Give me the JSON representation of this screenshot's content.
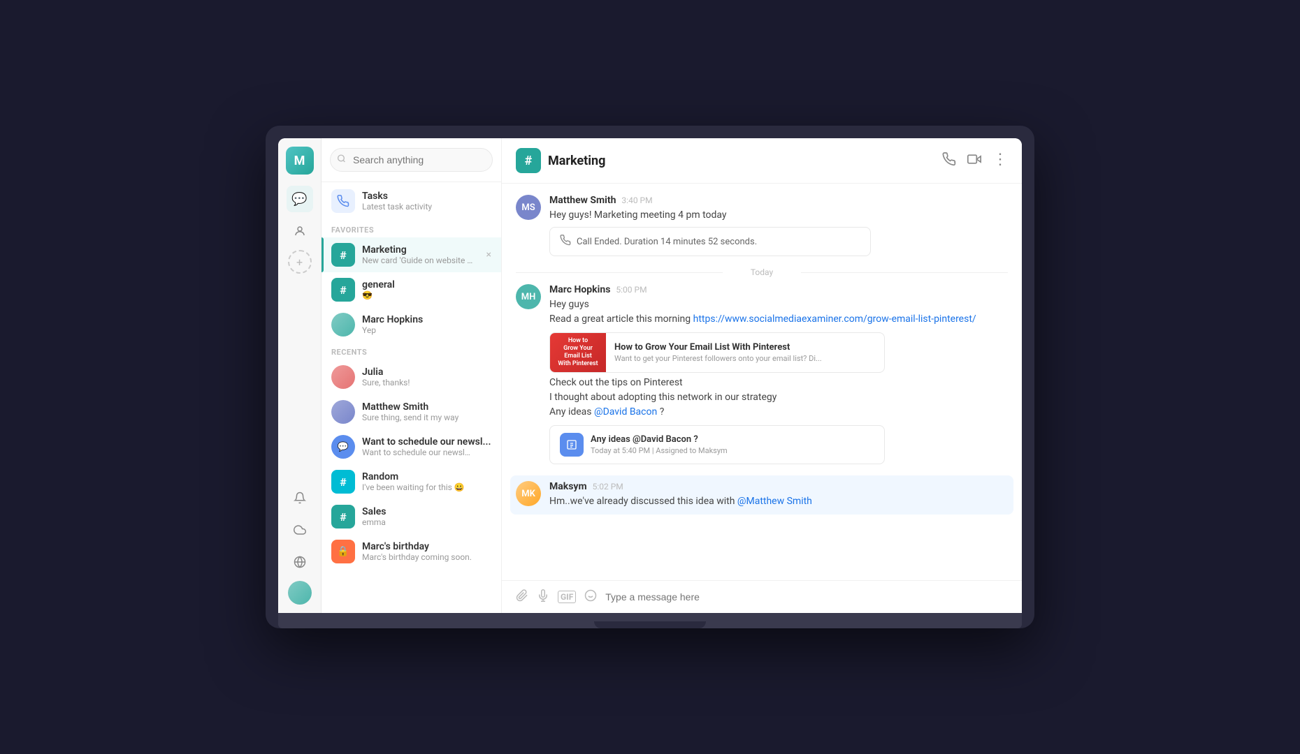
{
  "app": {
    "user_initial": "M",
    "channel_header": "Marketing"
  },
  "search": {
    "placeholder": "Search anything"
  },
  "tasks": {
    "title": "Tasks",
    "subtitle": "Latest task activity"
  },
  "sidebar": {
    "favorites_label": "FAVORITES",
    "recents_label": "RECENTS",
    "favorites": [
      {
        "id": "marketing",
        "type": "channel",
        "color": "green",
        "name": "Marketing",
        "preview": "New card 'Guide on website o...",
        "active": true
      },
      {
        "id": "general",
        "type": "channel",
        "color": "green",
        "name": "general",
        "preview": "😎",
        "active": false
      },
      {
        "id": "marc-hopkins",
        "type": "dm",
        "name": "Marc Hopkins",
        "preview": "Yep",
        "active": false
      }
    ],
    "recents": [
      {
        "id": "julia",
        "type": "dm",
        "name": "Julia",
        "preview": "Sure, thanks!",
        "active": false
      },
      {
        "id": "matthew-smith",
        "type": "dm",
        "name": "Matthew Smith",
        "preview": "Sure thing, send it my way",
        "active": false
      },
      {
        "id": "newsletter",
        "type": "dm",
        "color": "blue",
        "name": "Want to schedule our newsl...",
        "preview": "Want to schedule our newslet...",
        "active": false
      },
      {
        "id": "random",
        "type": "channel",
        "color": "teal2",
        "name": "Random",
        "preview": "I've been waiting for this 😀",
        "active": false
      },
      {
        "id": "sales",
        "type": "channel",
        "color": "green",
        "name": "Sales",
        "preview": "emma",
        "active": false
      },
      {
        "id": "marcs-birthday",
        "type": "dm",
        "color": "orange",
        "name": "Marc's birthday",
        "preview": "Marc's birthday coming soon.",
        "active": false
      }
    ]
  },
  "chat": {
    "channel_name": "Marketing",
    "messages": [
      {
        "id": "msg1",
        "author": "Matthew Smith",
        "time": "3:40 PM",
        "avatar_class": "ms",
        "text": "Hey guys! Marketing meeting 4 pm today",
        "has_call_ended": true,
        "call_ended_text": "Call Ended. Duration 14 minutes 52 seconds."
      },
      {
        "id": "msg2",
        "author": "Marc Hopkins",
        "time": "5:00 PM",
        "avatar_class": "mh",
        "text_lines": [
          "Hey guys",
          "Read a great article this morning"
        ],
        "link_url": "https://www.socialmediaexiner.com/grow-email-list-pinterest/",
        "link_display": "https://www.socialmediaexaminer.com/grow-email-list-pinterest/",
        "link_preview_title": "How to Grow Your Email List With Pinterest",
        "link_preview_desc": "Want to get your Pinterest followers onto your email list? Di...",
        "extra_lines": [
          "Check out the tips on Pinterest",
          "I thought about adopting this network in our strategy"
        ],
        "mention": "@David Bacon",
        "mention_suffix": " ?",
        "has_task_card": true,
        "task_card_title": "Any ideas @David Bacon ?",
        "task_card_sub": "Today at 5:40 PM | Assigned to Maksym"
      },
      {
        "id": "msg3",
        "author": "Maksym",
        "time": "5:02 PM",
        "avatar_class": "mk",
        "highlighted": true,
        "text_before": "Hm..we've already discussed this idea with ",
        "mention": "@Matthew Smith",
        "text_after": ""
      }
    ],
    "today_label": "Today",
    "input_placeholder": "Type a message here"
  },
  "icons": {
    "search": "🔍",
    "tasks": "📡",
    "hash": "#",
    "phone": "📞",
    "video": "📹",
    "more": "⋮",
    "call_ended": "📞",
    "attachment": "📎",
    "mic": "🎙",
    "gif": "GIF",
    "emoji": "😊",
    "messages_nav": "💬",
    "contacts_nav": "👤",
    "notifications_nav": "🔔",
    "cloud_nav": "☁",
    "globe_nav": "🌐",
    "add": "+"
  }
}
